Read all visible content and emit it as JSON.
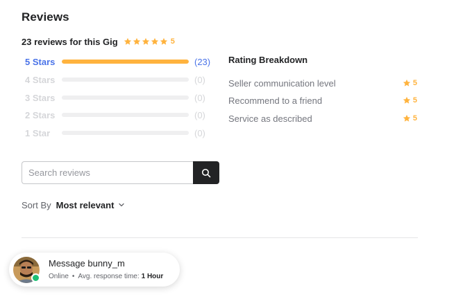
{
  "reviews": {
    "title": "Reviews",
    "summary_text": "23 reviews for this Gig",
    "average_rating": "5",
    "summary_stars": 5,
    "star_color": "#ffb33e"
  },
  "distribution": [
    {
      "label": "5 Stars",
      "count": "(23)",
      "fraction": 1.0,
      "active": true
    },
    {
      "label": "4 Stars",
      "count": "(0)",
      "fraction": 0,
      "active": false
    },
    {
      "label": "3 Stars",
      "count": "(0)",
      "fraction": 0,
      "active": false
    },
    {
      "label": "2 Stars",
      "count": "(0)",
      "fraction": 0,
      "active": false
    },
    {
      "label": "1 Star",
      "count": "(0)",
      "fraction": 0,
      "active": false
    }
  ],
  "breakdown": {
    "title": "Rating Breakdown",
    "items": [
      {
        "label": "Seller communication level",
        "value": "5"
      },
      {
        "label": "Recommend to a friend",
        "value": "5"
      },
      {
        "label": "Service as described",
        "value": "5"
      }
    ]
  },
  "search": {
    "placeholder": "Search reviews",
    "value": "",
    "icon": "search-icon"
  },
  "sort": {
    "label": "Sort By",
    "value": "Most relevant",
    "icon": "chevron-down-icon"
  },
  "chat": {
    "title": "Message bunny_m",
    "status": "Online",
    "separator": "•",
    "response_label": "Avg. response time:",
    "response_value": "1 Hour",
    "status_color": "#1dbf73"
  },
  "colors": {
    "accent_link": "#4a73e8",
    "star": "#ffb33e",
    "online": "#1dbf73"
  }
}
